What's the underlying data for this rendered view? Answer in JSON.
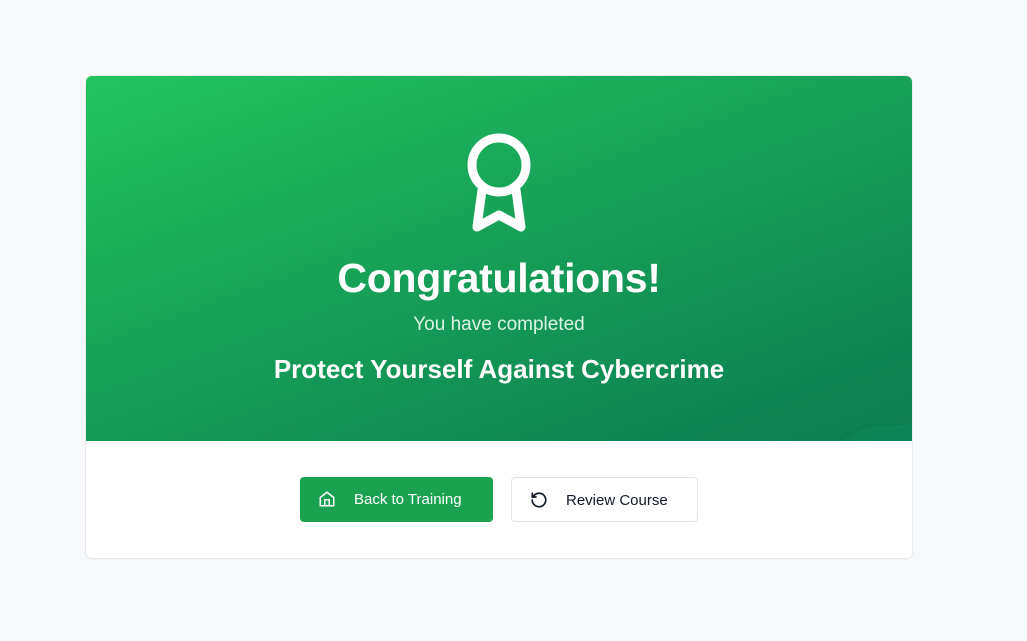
{
  "completion": {
    "title": "Congratulations!",
    "subtitle": "You have completed",
    "course_name": "Protect Yourself Against Cybercrime",
    "icon": "award-icon"
  },
  "actions": {
    "back_label": "Back to Training",
    "back_icon": "home-icon",
    "review_label": "Review Course",
    "review_icon": "rotate-ccw-icon"
  },
  "colors": {
    "page_background": "#f7f8fa",
    "hero_gradient_start": "#22c45e",
    "hero_gradient_end": "#0b7c52",
    "primary_button": "#1ba250"
  }
}
